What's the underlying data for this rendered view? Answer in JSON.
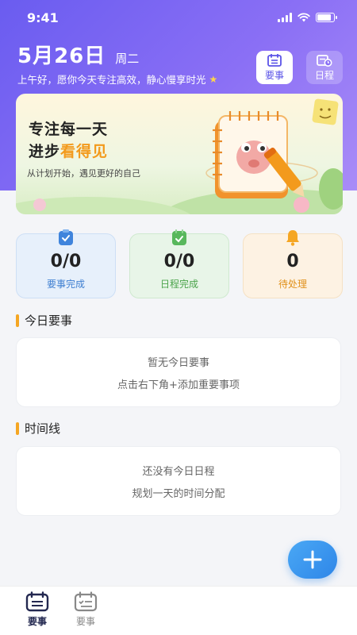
{
  "status_bar": {
    "time": "9:41"
  },
  "header": {
    "date": "5月26日",
    "weekday": "周二",
    "greeting": "上午好，愿你今天专注高效，静心慢享时光",
    "buttons": [
      {
        "label": "要事",
        "icon": "list-icon",
        "active": true
      },
      {
        "label": "日程",
        "icon": "calendar-clock-icon",
        "active": false
      }
    ]
  },
  "banner": {
    "title_line1": "专注每一天",
    "title_line2_prefix": "进步",
    "title_line2_highlight": "看得见",
    "subtitle": "从计划开始，遇见更好的自己"
  },
  "stats": [
    {
      "value": "0/0",
      "label": "要事完成",
      "icon": "clipboard-check-icon",
      "color": "#3f7fd1"
    },
    {
      "value": "0/0",
      "label": "日程完成",
      "icon": "calendar-check-icon",
      "color": "#4aa34a"
    },
    {
      "value": "0",
      "label": "待处理",
      "icon": "bell-icon",
      "color": "#e0901a"
    }
  ],
  "sections": {
    "today": {
      "title": "今日要事",
      "empty_line1": "暂无今日要事",
      "empty_line2": "点击右下角+添加重要事项"
    },
    "timeline": {
      "title": "时间线",
      "empty_line1": "还没有今日日程",
      "empty_line2": "规划一天的时间分配"
    }
  },
  "fab": {
    "icon": "plus-icon"
  },
  "tabbar": [
    {
      "label": "要事",
      "icon": "task-calendar-icon",
      "active": true
    },
    {
      "label": "要事",
      "icon": "task-calendar-icon",
      "active": false
    }
  ],
  "colors": {
    "accent": "#6a5cf0",
    "highlight": "#f39a1c",
    "fab": "#2e86e8"
  }
}
